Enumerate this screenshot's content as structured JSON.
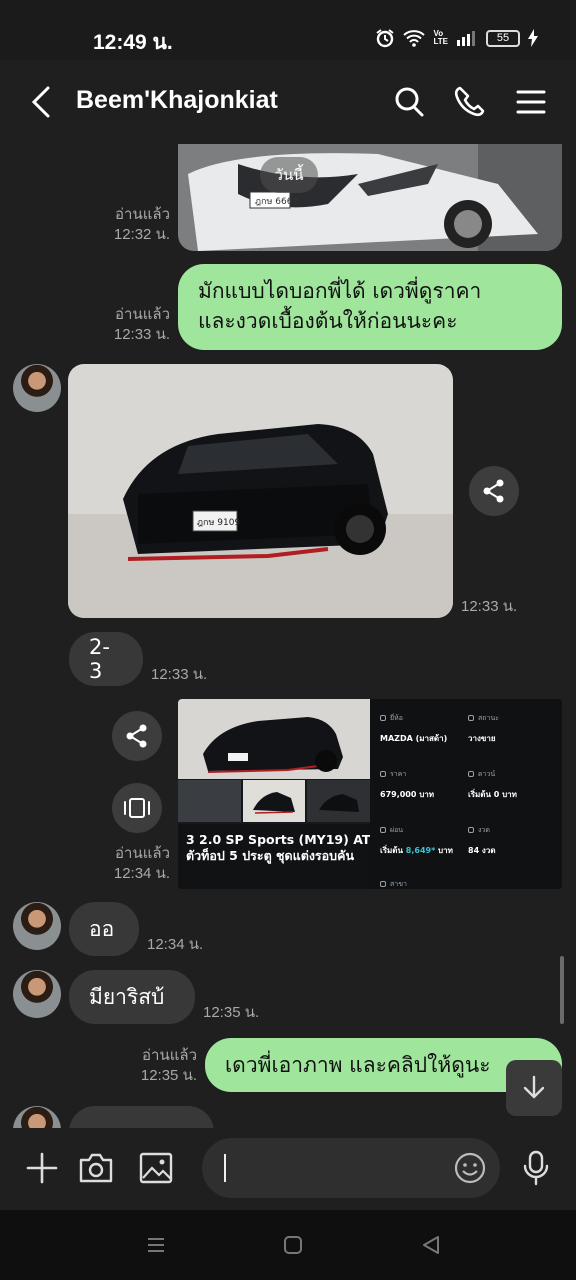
{
  "status_bar": {
    "time": "12:49 น.",
    "battery": "55",
    "network_label": "Vo LTE"
  },
  "header": {
    "title": "Beem'Khajonkiat"
  },
  "chat": {
    "date_chip": "วันนี้",
    "messages": [
      {
        "id": "m1",
        "side": "out",
        "type": "image",
        "read": "อ่านแล้ว",
        "time": "12:32 น."
      },
      {
        "id": "m2",
        "side": "out",
        "type": "text",
        "lines": [
          "มักแบบไดบอกพี่ได้ เดวพี่ดูราคา",
          "และงวดเบื้องต้นให้ก่อนนะคะ"
        ],
        "read": "อ่านแล้ว",
        "time": "12:33 น."
      },
      {
        "id": "m3",
        "side": "in",
        "type": "image",
        "time": "12:33 น."
      },
      {
        "id": "m4",
        "side": "in",
        "type": "text",
        "text": "2-3",
        "time": "12:33 น."
      },
      {
        "id": "m5",
        "side": "out",
        "type": "card",
        "read": "อ่านแล้ว",
        "time": "12:34 น.",
        "card": {
          "caption_lines": [
            "3 2.0 SP Sports (MY19) AT",
            "ตัวท็อป 5 ประตู ชุดแต่งรอบคัน"
          ],
          "specs": [
            {
              "label": "ยี่ห้อ",
              "value": "MAZDA (มาสด้า)"
            },
            {
              "label": "สถานะ",
              "value": "วางขาย"
            },
            {
              "label": "ราคา",
              "value": "679,000 บาท"
            },
            {
              "label": "ดาวน์",
              "value": "เริ่มต้น 0 บาท"
            },
            {
              "label": "ผ่อน",
              "value_prefix": "เริ่มต้น ",
              "value_accent": "8,649*",
              "value_suffix": " บาท"
            },
            {
              "label": "งวด",
              "value": "84 งวด"
            },
            {
              "label": "สาขา",
              "value": ""
            }
          ]
        }
      },
      {
        "id": "m6",
        "side": "in",
        "type": "text",
        "text": "ออ",
        "time": "12:34 น."
      },
      {
        "id": "m7",
        "side": "in",
        "type": "text",
        "text": "มียาริสบ้",
        "time": "12:35 น."
      },
      {
        "id": "m8",
        "side": "out",
        "type": "text",
        "text": "เดวพี่เอาภาพ และคลิปให้ดูนะ",
        "read": "อ่านแล้ว",
        "time": "12:35 น."
      },
      {
        "id": "m9",
        "side": "in",
        "type": "text",
        "text": ""
      }
    ]
  },
  "composer": {
    "placeholder": "",
    "value": ""
  },
  "icons": {
    "back": "back-arrow-icon",
    "search": "search-icon",
    "call": "phone-icon",
    "menu": "menu-icon",
    "share": "share-icon",
    "gallery_view": "carousel-icon",
    "scroll_down": "arrow-down-icon",
    "add": "plus-icon",
    "camera": "camera-icon",
    "image": "image-icon",
    "emoji": "emoji-icon",
    "mic": "mic-icon"
  },
  "colors": {
    "outgoing_bubble": "#9fe59b",
    "incoming_bubble": "#383838",
    "background": "#1f1f1f",
    "accent": "#39c4d7"
  }
}
